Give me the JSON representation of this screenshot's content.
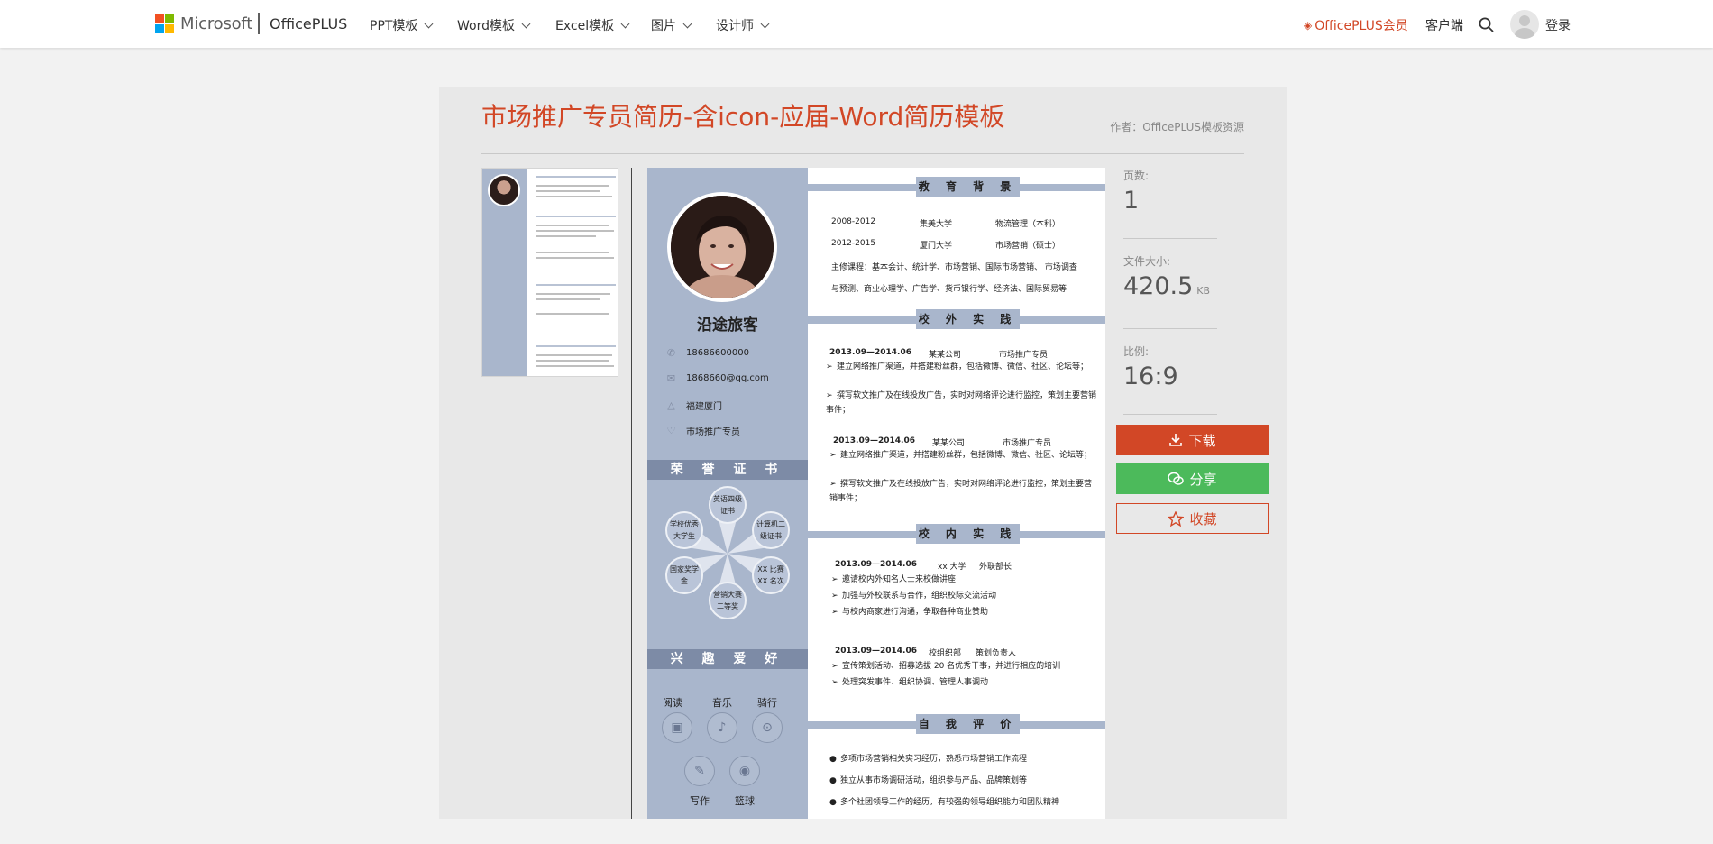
{
  "header": {
    "brand_ms": "Microsoft",
    "brand_product": "OfficePLUS",
    "nav": [
      {
        "label": "PPT模板"
      },
      {
        "label": "Word模板"
      },
      {
        "label": "Excel模板"
      },
      {
        "label": "图片"
      },
      {
        "label": "设计师"
      }
    ],
    "vip_label": "OfficePLUS会员",
    "client_label": "客户端",
    "login_label": "登录",
    "icons": [
      "microsoft-logo",
      "chevron-down-icon",
      "diamond-icon",
      "search-icon",
      "avatar-icon"
    ]
  },
  "detail": {
    "title": "市场推广专员简历-含icon-应届-Word简历模板",
    "author": "作者：OfficePLUS模板资源",
    "meta": {
      "pages_label": "页数:",
      "pages_value": "1",
      "size_label": "文件大小:",
      "size_value": "420.5",
      "size_unit": "KB",
      "ratio_label": "比例:",
      "ratio_value": "16:9"
    },
    "buttons": {
      "download": "下载",
      "share": "分享",
      "favorite": "收藏"
    }
  },
  "resume": {
    "name": "沿途旅客",
    "contacts": [
      {
        "icon": "phone-icon",
        "text": "18686600000"
      },
      {
        "icon": "mail-icon",
        "text": "1868660@qq.com"
      },
      {
        "icon": "location-icon",
        "text": "福建厦门"
      },
      {
        "icon": "heart-icon",
        "text": "市场推广专员"
      }
    ],
    "honors_title": "荣 誉 证 书",
    "honors": [
      "英语四级证书",
      "计算机二级证书",
      "XX 比赛XX 名次",
      "营销大赛二等奖",
      "国家奖学金",
      "学校优秀大学生"
    ],
    "hobbies_title": "兴 趣 爱 好",
    "hobbies": [
      {
        "label": "阅读",
        "icon": "book-icon"
      },
      {
        "label": "音乐",
        "icon": "music-icon"
      },
      {
        "label": "骑行",
        "icon": "bike-icon"
      },
      {
        "label": "写作",
        "icon": "write-icon"
      },
      {
        "label": "篮球",
        "icon": "ball-icon"
      }
    ],
    "education_title": "教 育 背 景",
    "education": [
      {
        "period": "2008-2012",
        "school": "集美大学",
        "major": "物流管理（本科）"
      },
      {
        "period": "2012-2015",
        "school": "厦门大学",
        "major": "市场营销（硕士）"
      }
    ],
    "courses_1": "主修课程：基本会计、统计学、市场营销、国际市场营销、 市场调查",
    "courses_2": "与预测、商业心理学、广告学、货币银行学、经济法、国际贸易等",
    "external_title": "校 外 实 践",
    "external": [
      {
        "period": "2013.09—2014.06",
        "company": "某某公司",
        "role": "市场推广专员",
        "items": [
          "建立网络推广渠道，并搭建粉丝群，包括微博、微信、社区、论坛等；",
          "撰写软文推广及在线投放广告，实时对网络评论进行监控，策划主要营销事件；"
        ]
      },
      {
        "period": "2013.09—2014.06",
        "company": "某某公司",
        "role": "市场推广专员",
        "items": [
          "建立网络推广渠道，并搭建粉丝群，包括微博、微信、社区、论坛等；",
          "撰写软文推广及在线投放广告，实时对网络评论进行监控，策划主要营销事件；"
        ]
      }
    ],
    "internal_title": "校 内 实 践",
    "internal": [
      {
        "period": "2013.09—2014.06",
        "org": "xx 大学",
        "role": "外联部长",
        "items": [
          "邀请校内外知名人士来校做讲座",
          "加强与外校联系与合作，组织校际交流活动",
          "与校内商家进行沟通，争取各种商业赞助"
        ]
      },
      {
        "period": "2013.09—2014.06",
        "org": "校组织部",
        "role": "策划负责人",
        "items": [
          "宣传策划活动、招募选拔 20 名优秀干事，并进行相应的培训",
          "处理突发事件、组织协调、管理人事调动"
        ]
      }
    ],
    "self_title": "自 我 评 价",
    "self": [
      "多项市场营销相关实习经历，熟悉市场营销工作流程",
      "独立从事市场调研活动，组织参与产品、品牌策划等",
      "多个社团领导工作的经历，有较强的领导组织能力和团队精神"
    ]
  },
  "colors": {
    "accent": "#d24726",
    "share": "#4cba5b",
    "resume_band": "#a9b6cc",
    "resume_band_dark": "#7d8ba6"
  }
}
